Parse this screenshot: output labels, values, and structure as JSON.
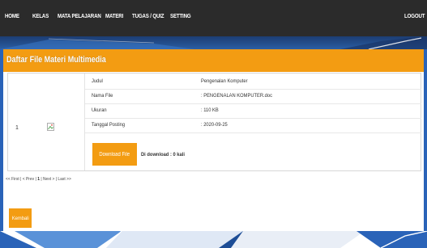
{
  "nav": {
    "items": [
      "HOME",
      "KELAS",
      "MATA PELAJARAN",
      "MATERI",
      "TUGAS / QUIZ",
      "SETTING"
    ],
    "logout": "LOGOUT"
  },
  "panel": {
    "title": "Daftar File Materi Multimedia"
  },
  "row": {
    "no": "1",
    "fields": [
      {
        "label": "Judul",
        "value": "Pengenalan Komputer"
      },
      {
        "label": "Nama File",
        "value": ": PENGENALAN KOMPUTER.doc"
      },
      {
        "label": "Ukuran",
        "value": ": 110 KB"
      },
      {
        "label": "Tanggal Posting",
        "value": ": 2020-09-25"
      }
    ],
    "download_label": "Download File",
    "download_count": "Di download : 0 kali"
  },
  "pager": {
    "first": "<< First",
    "prev": "< Prev",
    "current": "1",
    "next": "Next >",
    "last": "Last >>"
  },
  "back_label": "Kembali",
  "colors": {
    "nav_bg": "#2b2b2b",
    "accent": "#f39c12",
    "blue": "#2a63b8"
  },
  "icons": {
    "broken_image": "broken-image-icon"
  }
}
